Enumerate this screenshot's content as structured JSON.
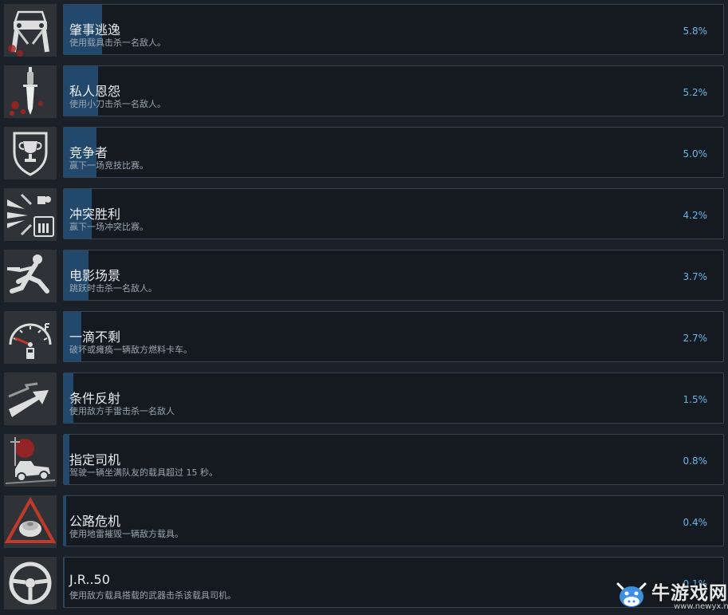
{
  "achievements": [
    {
      "title": "肇事逃逸",
      "description": "使用载具击杀一名敌人。",
      "percent_label": "5.8%",
      "percent": 5.8,
      "icon": "car-crash-icon"
    },
    {
      "title": "私人恩怨",
      "description": "使用小刀击杀一名敌人。",
      "percent_label": "5.2%",
      "percent": 5.2,
      "icon": "knife-icon"
    },
    {
      "title": "竞争者",
      "description": "赢下一场竞技比赛。",
      "percent_label": "5.0%",
      "percent": 5.0,
      "icon": "trophy-shield-icon"
    },
    {
      "title": "冲突胜利",
      "description": "赢下一场冲突比赛。",
      "percent_label": "4.2%",
      "percent": 4.2,
      "icon": "conflict-arrows-icon"
    },
    {
      "title": "电影场景",
      "description": "跳跃时击杀一名敌人。",
      "percent_label": "3.7%",
      "percent": 3.7,
      "icon": "jumping-soldier-icon"
    },
    {
      "title": "一滴不剩",
      "description": "破坏或瘫痪一辆敌方燃料卡车。",
      "percent_label": "2.7%",
      "percent": 2.7,
      "icon": "fuel-gauge-icon"
    },
    {
      "title": "条件反射",
      "description": "使用敌方手雷击杀一名敌人",
      "percent_label": "1.5%",
      "percent": 1.5,
      "icon": "return-arrow-icon"
    },
    {
      "title": "指定司机",
      "description": "驾驶一辆坐满队友的载具超过 15 秒。",
      "percent_label": "0.8%",
      "percent": 0.8,
      "icon": "jeep-icon"
    },
    {
      "title": "公路危机",
      "description": "使用地雷摧毁一辆敌方载具。",
      "percent_label": "0.4%",
      "percent": 0.4,
      "icon": "landmine-warning-icon"
    },
    {
      "title": "J.R..50",
      "description": "使用敌方载具搭载的武器击杀该载具司机。",
      "percent_label": "0.1%",
      "percent": 0.1,
      "icon": "steering-wheel-icon"
    }
  ],
  "watermark": {
    "name": "牛游戏网",
    "url": "www.newyx.net",
    "icon": "cow-logo-icon"
  },
  "colors": {
    "bar": "#22496b",
    "percent": "#66b4e8",
    "panel": "#151a20",
    "border": "#3a4350"
  }
}
